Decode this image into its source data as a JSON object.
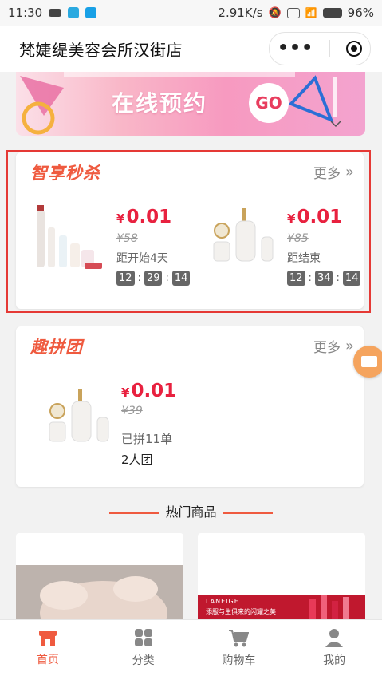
{
  "status": {
    "time": "11:30",
    "network": "2.91K/s",
    "battery": "96%"
  },
  "navbar": {
    "title": "梵婕缇美容会所汉街店"
  },
  "banner": {
    "text": "在线预约",
    "badge": "GO"
  },
  "flash_sale": {
    "title": "智享秒杀",
    "more": "更多",
    "items": [
      {
        "price": "0.01",
        "currency": "¥",
        "old_price": "¥58",
        "note": "距开始4天",
        "timer": [
          "12",
          "29",
          "14"
        ]
      },
      {
        "price": "0.01",
        "currency": "¥",
        "old_price": "¥85",
        "note": "距结束",
        "timer": [
          "12",
          "34",
          "14"
        ]
      }
    ]
  },
  "group_buy": {
    "title": "趣拼团",
    "more": "更多",
    "item": {
      "price": "0.01",
      "currency": "¥",
      "old_price": "¥39",
      "sold": "已拼11单",
      "group": "2人团"
    }
  },
  "hot": {
    "title": "热门商品",
    "product2_brand": "LANEIGE",
    "product2_slogan": "添服与生俱来的闪耀之美"
  },
  "tabbar": {
    "tabs": [
      {
        "label": "首页",
        "icon": "store-icon",
        "active": true
      },
      {
        "label": "分类",
        "icon": "grid-icon"
      },
      {
        "label": "购物车",
        "icon": "cart-icon"
      },
      {
        "label": "我的",
        "icon": "person-icon"
      }
    ]
  },
  "colors": {
    "accent": "#ef5a3f",
    "price": "#e8213f",
    "highlight": "#e53935"
  }
}
